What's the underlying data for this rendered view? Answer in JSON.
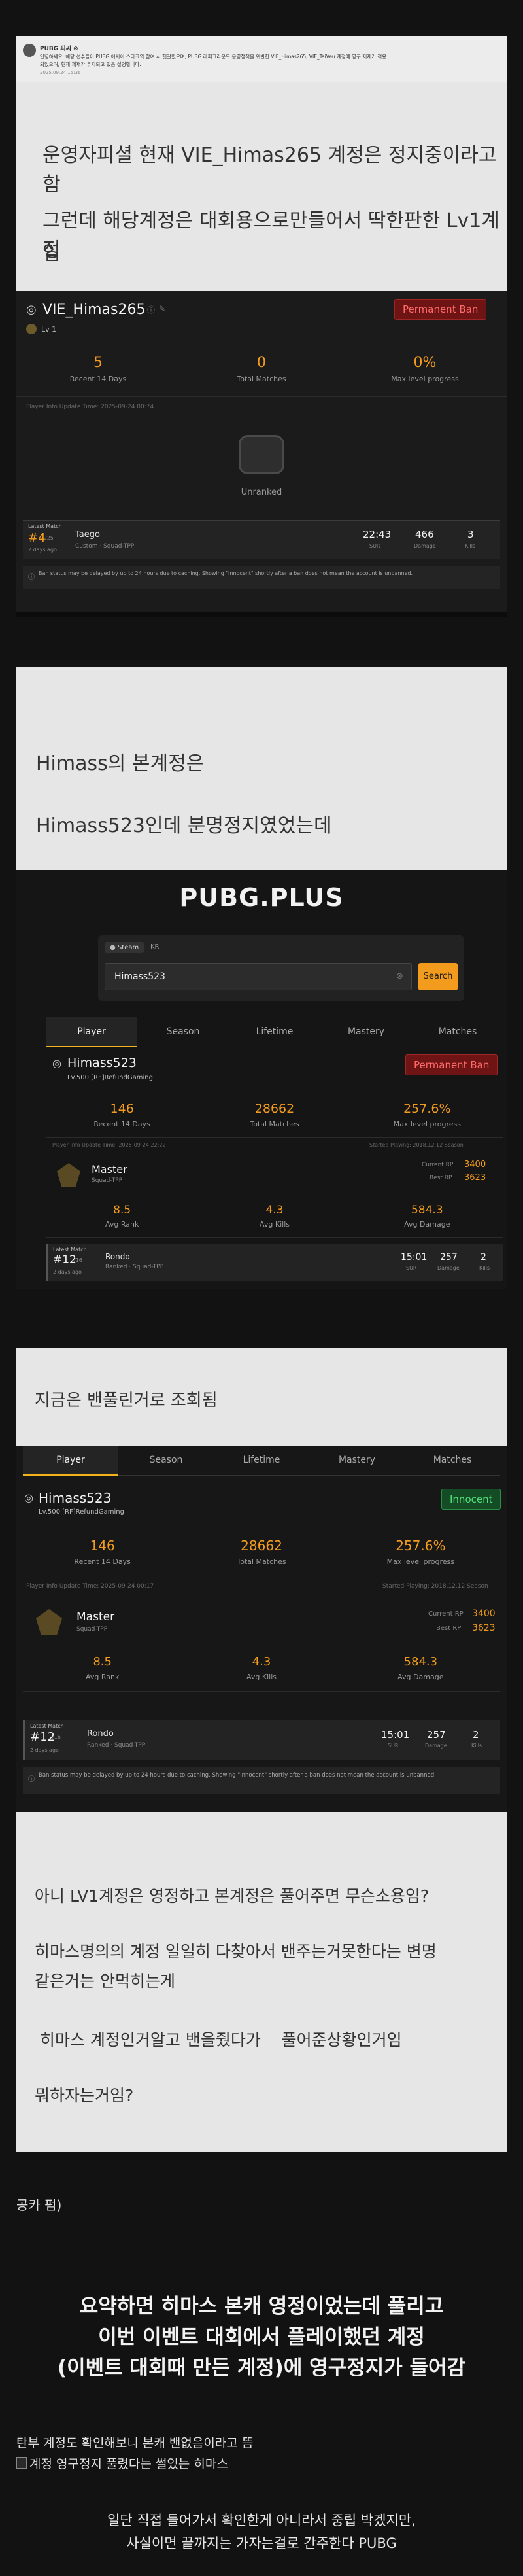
{
  "notice": {
    "author": "PUBG 피씨 ⊘",
    "line1": "안녕하세요, 해당 선수들이 PUBG 어서이 스타크의 참여 시 헷갈렸으며, PUBG 레퍼그라운드 운영정책을 위반한 VIE_Himas265, VIE_TaiVeu 계정에 영구 제재가 적용",
    "line2": "되었으며, 현재 제재가 유지되고 있음 설명합니다.",
    "date": "2025.09.24 15:36"
  },
  "panel1": {
    "line1": "운영자피셜 현재 VIE_Himas265 계정은 정지중이라고함",
    "line2": "그런데 해당계정은  대회용으로만들어서 딱한판한 Lv1계정",
    "line3": "임"
  },
  "card1": {
    "name": "VIE_Himas265",
    "level": "Lv 1",
    "badge": "Permanent Ban",
    "stats": [
      {
        "value": "5",
        "label": "Recent 14 Days"
      },
      {
        "value": "0",
        "label": "Total Matches"
      },
      {
        "value": "0%",
        "label": "Max level progress"
      }
    ],
    "update": "Player Info Update Time: 2025-09-24 00:74",
    "rank_label": "Unranked",
    "match": {
      "head": "Latest Match",
      "place": "#4",
      "place_sub": "/25",
      "ago": "2 days ago",
      "map": "Taego",
      "mode": "Custom · Squad-TPP",
      "time": "22:43",
      "time_lbl": "SUR",
      "dmg": "466",
      "dmg_lbl": "Damage",
      "kills": "3",
      "kills_lbl": "Kills"
    },
    "note": "Ban status may be delayed by up to 24 hours due to caching. Showing \"Innocent\" shortly after a ban does not mean the account is unbanned."
  },
  "panel2": {
    "line1": "Himass의 본계정은",
    "line2": "Himass523인데 분명정지였었는데"
  },
  "pubgplus": {
    "logo": "PUBG.PLUS",
    "platform": "Steam",
    "region": "KR",
    "search_value": "Himass523",
    "search_button": "Search",
    "tabs": [
      "Player",
      "Season",
      "Lifetime",
      "Mastery",
      "Matches"
    ],
    "name": "Himass523",
    "level": "Lv.500 [RF]RefundGaming",
    "badge": "Permanent Ban",
    "stats": [
      {
        "value": "146",
        "label": "Recent 14 Days"
      },
      {
        "value": "28662",
        "label": "Total Matches"
      },
      {
        "value": "257.6%",
        "label": "Max level progress"
      }
    ],
    "update": "Player Info Update Time: 2025-09-24 22:22",
    "season": "Started Playing: 2018.12.12 Season",
    "tier": "Master",
    "tier_mode": "Squad-TPP",
    "current_rp_label": "Current RP",
    "current_rp": "3400",
    "best_rp_label": "Best RP",
    "best_rp": "3623",
    "avgs": [
      {
        "value": "8.5",
        "label": "Avg Rank"
      },
      {
        "value": "4.3",
        "label": "Avg Kills"
      },
      {
        "value": "584.3",
        "label": "Avg Damage"
      }
    ],
    "match": {
      "head": "Latest Match",
      "place": "#12",
      "place_sub": "/16",
      "ago": "2 days ago",
      "map": "Rondo",
      "mode": "Ranked · Squad-TPP",
      "time": "15:01",
      "time_lbl": "SUR",
      "dmg": "257",
      "dmg_lbl": "Damage",
      "kills": "2",
      "kills_lbl": "Kills"
    }
  },
  "panel3": {
    "line1": "지금은 밴풀린거로 조회됨"
  },
  "card3": {
    "tabs": [
      "Player",
      "Season",
      "Lifetime",
      "Mastery",
      "Matches"
    ],
    "name": "Himass523",
    "level": "Lv.500 [RF]RefundGaming",
    "badge": "Innocent",
    "stats": [
      {
        "value": "146",
        "label": "Recent 14 Days"
      },
      {
        "value": "28662",
        "label": "Total Matches"
      },
      {
        "value": "257.6%",
        "label": "Max level progress"
      }
    ],
    "update": "Player Info Update Time: 2025-09-24 00:17",
    "season": "Started Playing: 2018.12.12 Season",
    "tier": "Master",
    "tier_mode": "Squad-TPP",
    "current_rp_label": "Current RP",
    "current_rp": "3400",
    "best_rp_label": "Best RP",
    "best_rp": "3623",
    "avgs": [
      {
        "value": "8.5",
        "label": "Avg Rank"
      },
      {
        "value": "4.3",
        "label": "Avg Kills"
      },
      {
        "value": "584.3",
        "label": "Avg Damage"
      }
    ],
    "match": {
      "head": "Latest Match",
      "place": "#12",
      "place_sub": "/16",
      "ago": "2 days ago",
      "map": "Rondo",
      "mode": "Ranked · Squad-TPP",
      "time": "15:01",
      "time_lbl": "SUR",
      "dmg": "257",
      "dmg_lbl": "Damage",
      "kills": "2",
      "kills_lbl": "Kills"
    },
    "note": "Ban status may be delayed by up to 24 hours due to caching. Showing \"Innocent\" shortly after a ban does not mean the account is unbanned."
  },
  "panel4": {
    "line1": "아니 LV1계정은 영정하고 본계정은 풀어주면 무슨소용임?",
    "line2": "히마스명의의 계정 일일히 다찾아서 밴주는거못한다는 변명",
    "line3": "같은거는 안먹히는게",
    "line4": " 히마스 계정인거알고 밴을줬다가    풀어준상황인거임",
    "line5": "뭐하자는거임?"
  },
  "footer": {
    "credit": "공카 펌)",
    "summary1": "요약하면 히마스 본캐 영정이었는데 풀리고",
    "summary2": "이번 이벤트 대회에서 플레이했던 계정",
    "summary3": "(이벤트 대회때 만든 계정)에 영구정지가 들어감",
    "line_a": "탄부 계정도 확인해보니 본캐 밴없음이라고 뜸",
    "broken_alt": "계정 영구정지 풀렸다는 썰있는 히마스",
    "final1": "일단 직접 들어가서 확인한게 아니라서 중립 박겠지만,",
    "final2": "사실이면 끝까지는 가자는걸로 간주한다 PUBG"
  }
}
